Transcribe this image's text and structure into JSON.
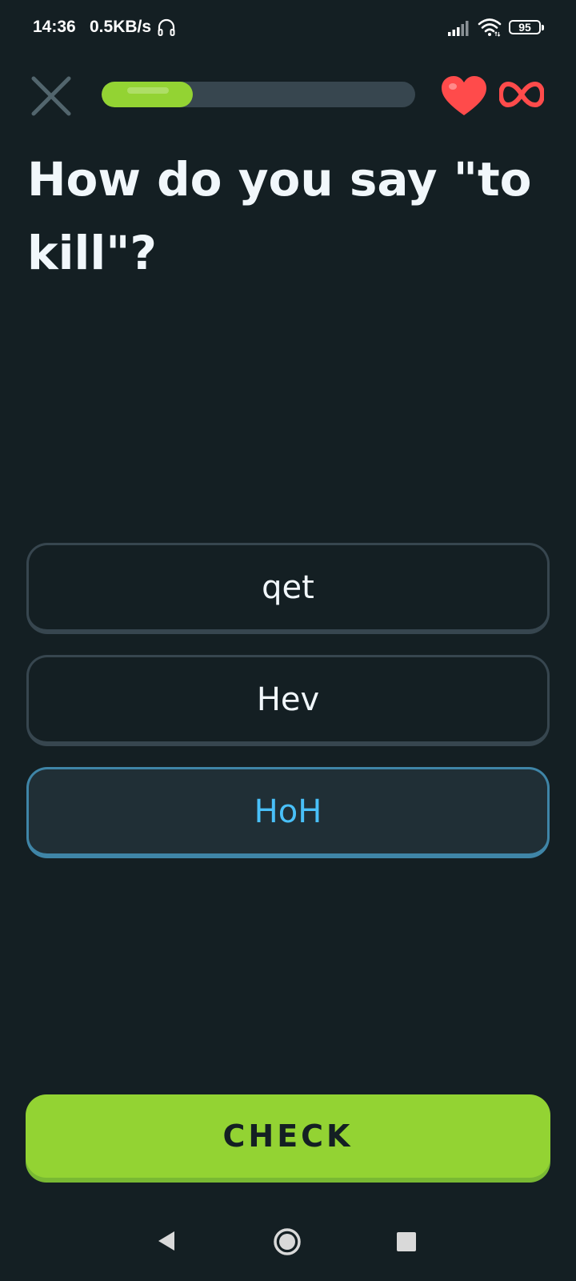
{
  "status_bar": {
    "time": "14:36",
    "network_speed": "0.5KB/s",
    "battery_level": "95"
  },
  "lesson_header": {
    "progress_fraction": 0.29,
    "hearts": "∞",
    "colors": {
      "progress_fill": "#93d333",
      "progress_track": "#37464f",
      "heart": "#ff4b4b"
    }
  },
  "prompt": {
    "text": "How do you say \"to kill\"?"
  },
  "options": [
    {
      "label": "qet",
      "selected": false
    },
    {
      "label": "Hev",
      "selected": false
    },
    {
      "label": "HoH",
      "selected": true
    }
  ],
  "check_button": {
    "label": "CHECK",
    "color": "#93d333"
  },
  "icons": {
    "close": "close-icon",
    "heart": "heart-icon",
    "infinity": "infinity-icon",
    "headphone": "headphone-icon",
    "signal": "signal-icon",
    "wifi": "wifi-icon"
  }
}
